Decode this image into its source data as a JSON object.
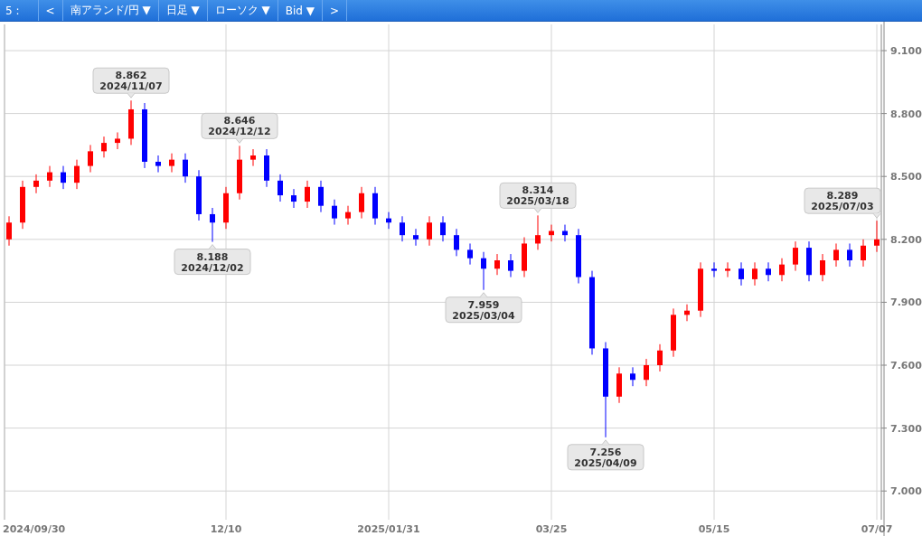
{
  "toolbar": [
    {
      "kind": "label",
      "text": "5 :"
    },
    {
      "kind": "button",
      "text": "<"
    },
    {
      "kind": "dropdown",
      "text": "南アランド/円 ▼"
    },
    {
      "kind": "dropdown",
      "text": "日足 ▼"
    },
    {
      "kind": "dropdown",
      "text": "ローソク ▼"
    },
    {
      "kind": "dropdown",
      "text": "Bid ▼"
    },
    {
      "kind": "button",
      "text": ">"
    }
  ],
  "chart": {
    "start_label": "2024/09/30",
    "chart_data": {
      "type": "candlestick",
      "grid": true,
      "categories": [
        null,
        null,
        null,
        null,
        null,
        null,
        null,
        null,
        null,
        null,
        null,
        null,
        null,
        null,
        null,
        null,
        "12/10",
        null,
        null,
        null,
        null,
        null,
        null,
        null,
        null,
        null,
        null,
        null,
        "2025/01/31",
        null,
        null,
        null,
        null,
        null,
        null,
        null,
        null,
        null,
        null,
        null,
        "03/25",
        null,
        null,
        null,
        null,
        null,
        null,
        null,
        null,
        null,
        null,
        null,
        "05/15",
        null,
        null,
        null,
        null,
        null,
        null,
        null,
        null,
        null,
        null,
        null,
        "07/07"
      ],
      "ylim": [
        6.863,
        9.225
      ],
      "yticks": [
        {
          "value": 7.0,
          "label": "7.000"
        },
        {
          "value": 7.3,
          "label": "7.300"
        },
        {
          "value": 7.6,
          "label": "7.600"
        },
        {
          "value": 7.9,
          "label": "7.900"
        },
        {
          "value": 8.2,
          "label": "8.200"
        },
        {
          "value": 8.5,
          "label": "8.500"
        },
        {
          "value": 8.8,
          "label": "8.800"
        },
        {
          "value": 9.1,
          "label": "9.100"
        }
      ],
      "ohlc": [
        [
          8.2,
          8.31,
          8.17,
          8.28
        ],
        [
          8.28,
          8.48,
          8.25,
          8.45
        ],
        [
          8.45,
          8.51,
          8.42,
          8.48
        ],
        [
          8.48,
          8.55,
          8.45,
          8.52
        ],
        [
          8.52,
          8.55,
          8.44,
          8.47
        ],
        [
          8.47,
          8.58,
          8.44,
          8.55
        ],
        [
          8.55,
          8.65,
          8.52,
          8.62
        ],
        [
          8.62,
          8.69,
          8.59,
          8.66
        ],
        [
          8.66,
          8.71,
          8.63,
          8.68
        ],
        [
          8.68,
          8.862,
          8.65,
          8.82
        ],
        [
          8.82,
          8.85,
          8.54,
          8.57
        ],
        [
          8.57,
          8.6,
          8.52,
          8.55
        ],
        [
          8.55,
          8.61,
          8.52,
          8.58
        ],
        [
          8.58,
          8.61,
          8.47,
          8.5
        ],
        [
          8.5,
          8.53,
          8.29,
          8.32
        ],
        [
          8.32,
          8.35,
          8.188,
          8.28
        ],
        [
          8.28,
          8.45,
          8.25,
          8.42
        ],
        [
          8.42,
          8.646,
          8.39,
          8.58
        ],
        [
          8.58,
          8.63,
          8.55,
          8.6
        ],
        [
          8.6,
          8.63,
          8.45,
          8.48
        ],
        [
          8.48,
          8.51,
          8.38,
          8.41
        ],
        [
          8.41,
          8.44,
          8.35,
          8.38
        ],
        [
          8.38,
          8.48,
          8.35,
          8.45
        ],
        [
          8.45,
          8.48,
          8.33,
          8.36
        ],
        [
          8.36,
          8.39,
          8.27,
          8.3
        ],
        [
          8.3,
          8.36,
          8.27,
          8.33
        ],
        [
          8.33,
          8.45,
          8.3,
          8.42
        ],
        [
          8.42,
          8.45,
          8.27,
          8.3
        ],
        [
          8.3,
          8.33,
          8.25,
          8.28
        ],
        [
          8.28,
          8.31,
          8.19,
          8.22
        ],
        [
          8.22,
          8.25,
          8.17,
          8.2
        ],
        [
          8.2,
          8.31,
          8.17,
          8.28
        ],
        [
          8.28,
          8.31,
          8.19,
          8.22
        ],
        [
          8.22,
          8.25,
          8.12,
          8.15
        ],
        [
          8.15,
          8.18,
          8.08,
          8.11
        ],
        [
          8.11,
          8.14,
          7.959,
          8.06
        ],
        [
          8.06,
          8.13,
          8.03,
          8.1
        ],
        [
          8.1,
          8.13,
          8.02,
          8.05
        ],
        [
          8.05,
          8.21,
          8.02,
          8.18
        ],
        [
          8.18,
          8.314,
          8.15,
          8.22
        ],
        [
          8.22,
          8.27,
          8.19,
          8.24
        ],
        [
          8.24,
          8.27,
          8.19,
          8.22
        ],
        [
          8.22,
          8.25,
          7.99,
          8.02
        ],
        [
          8.02,
          8.05,
          7.65,
          7.68
        ],
        [
          7.68,
          7.71,
          7.256,
          7.45
        ],
        [
          7.45,
          7.59,
          7.42,
          7.56
        ],
        [
          7.56,
          7.59,
          7.5,
          7.53
        ],
        [
          7.53,
          7.63,
          7.5,
          7.6
        ],
        [
          7.6,
          7.7,
          7.57,
          7.67
        ],
        [
          7.67,
          7.87,
          7.64,
          7.84
        ],
        [
          7.84,
          7.89,
          7.81,
          7.86
        ],
        [
          7.86,
          8.09,
          7.83,
          8.06
        ],
        [
          8.06,
          8.09,
          8.02,
          8.05
        ],
        [
          8.05,
          8.09,
          8.02,
          8.06
        ],
        [
          8.06,
          8.09,
          7.98,
          8.01
        ],
        [
          8.01,
          8.09,
          7.98,
          8.06
        ],
        [
          8.06,
          8.09,
          8.0,
          8.03
        ],
        [
          8.03,
          8.11,
          8.0,
          8.08
        ],
        [
          8.08,
          8.19,
          8.05,
          8.16
        ],
        [
          8.16,
          8.19,
          8.0,
          8.03
        ],
        [
          8.03,
          8.13,
          8.0,
          8.1
        ],
        [
          8.1,
          8.18,
          8.07,
          8.15
        ],
        [
          8.15,
          8.18,
          8.07,
          8.1
        ],
        [
          8.1,
          8.2,
          8.07,
          8.17
        ],
        [
          8.17,
          8.289,
          8.14,
          8.2
        ]
      ],
      "annotations": [
        "8.862\n2024/11/07",
        "8.188\n2024/12/02",
        "8.646\n2024/12/12",
        "7.959\n2025/03/04",
        "8.314\n2025/03/18",
        "7.256\n2025/04/09",
        "8.289\n2025/07/03"
      ]
    }
  }
}
